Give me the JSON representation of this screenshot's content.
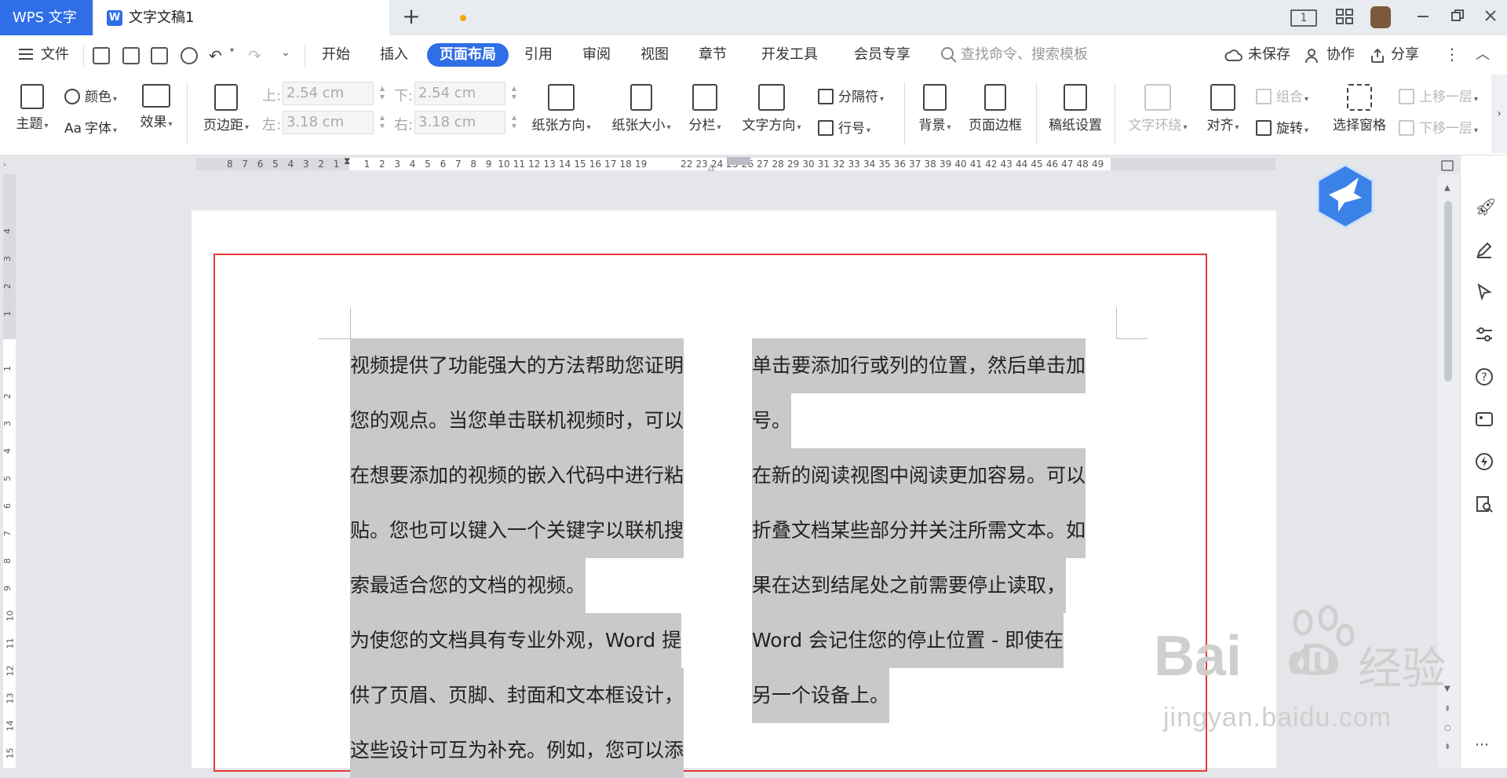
{
  "titlebar": {
    "app_name": "WPS 文字",
    "doc_tab_label": "文字文稿1",
    "doc_icon_letter": "W",
    "new_tab_symbol": "+",
    "page_indicator": "1"
  },
  "menu": {
    "file_label": "文件",
    "tabs": [
      "开始",
      "插入",
      "页面布局",
      "引用",
      "审阅",
      "视图",
      "章节",
      "开发工具",
      "会员专享"
    ],
    "active_tab": "页面布局",
    "search_placeholder": "查找命令、搜索模板",
    "unsaved_label": "未保存",
    "collab_label": "协作",
    "share_label": "分享"
  },
  "ribbon": {
    "theme": "主题",
    "color": "颜色",
    "font": "字体",
    "font_prefix": "Aa",
    "effect": "效果",
    "margins": "页边距",
    "margin_top_label": "上:",
    "margin_top_value": "2.54 cm",
    "margin_bottom_label": "下:",
    "margin_bottom_value": "2.54 cm",
    "margin_left_label": "左:",
    "margin_left_value": "3.18 cm",
    "margin_right_label": "右:",
    "margin_right_value": "3.18 cm",
    "orientation": "纸张方向",
    "size": "纸张大小",
    "columns": "分栏",
    "text_direction": "文字方向",
    "separator": "分隔符",
    "line_numbers": "行号",
    "background": "背景",
    "page_border": "页面边框",
    "grid_paper": "稿纸设置",
    "text_wrap": "文字环绕",
    "align": "对齐",
    "rotate": "旋转",
    "group": "组合",
    "selection_pane": "选择窗格",
    "bring_forward": "上移一层",
    "send_backward": "下移一层"
  },
  "ruler": {
    "left_ticks": [
      "8",
      "7",
      "6",
      "5",
      "4",
      "3",
      "2",
      "1"
    ],
    "right_ticks": [
      "1",
      "2",
      "3",
      "4",
      "5",
      "6",
      "7",
      "8",
      "9",
      "10",
      "11",
      "12",
      "13",
      "14",
      "15",
      "16",
      "17",
      "18",
      "19",
      "",
      "",
      "22",
      "23",
      "24",
      "25",
      "26",
      "27",
      "28",
      "29",
      "30",
      "31",
      "32",
      "33",
      "34",
      "35",
      "36",
      "37",
      "38",
      "39",
      "40",
      "41",
      "42",
      "43",
      "44",
      "45",
      "46",
      "47",
      "48",
      "49"
    ],
    "vertical_ticks": [
      "4",
      "3",
      "2",
      "1",
      "",
      "1",
      "2",
      "3",
      "4",
      "5",
      "6",
      "7",
      "8",
      "9",
      "10",
      "11",
      "12",
      "13",
      "14",
      "15"
    ]
  },
  "document": {
    "left_column": [
      "视频提供了功能强大的方法帮助您证明",
      "您的观点。当您单击联机视频时，可以",
      "在想要添加的视频的嵌入代码中进行粘",
      "贴。您也可以键入一个关键字以联机搜",
      "索最适合您的文档的视频。",
      "为使您的文档具有专业外观，Word 提",
      "供了页眉、页脚、封面和文本框设计，",
      "这些设计可互为补充。例如，您可以添"
    ],
    "right_column": [
      "单击要添加行或列的位置，然后单击加",
      "号。",
      "在新的阅读视图中阅读更加容易。可以",
      "折叠文档某些部分并关注所需文本。如",
      "果在达到结尾处之前需要停止读取，",
      "Word 会记住您的停止位置 - 即使在",
      "另一个设备上。",
      ""
    ]
  },
  "watermark": {
    "brand": "Bai",
    "brand2": "du",
    "cn": "经验",
    "url": "jingyan.baidu.com"
  },
  "colors": {
    "accent": "#2f6ee6",
    "border_red": "#e53935",
    "selection_gray": "#c9c9c9"
  }
}
